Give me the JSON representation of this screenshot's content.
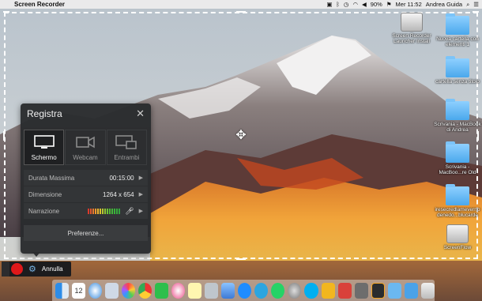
{
  "menubar": {
    "app_name": "Screen Recorder",
    "battery": "90%",
    "clock": "Mer 11:52",
    "user": "Andrea Guida"
  },
  "desktop_icons": [
    {
      "label": "Screen Recorder Launcher Install",
      "kind": "drive"
    },
    {
      "label": "Nuova cartella con elementi 1",
      "kind": "folder"
    },
    {
      "label": "cartella senza titolo",
      "kind": "folder"
    },
    {
      "label": "Scrivania - MacBook di Andrea",
      "kind": "folder"
    },
    {
      "label": "Scrivania - MacBoo...re Old",
      "kind": "folder"
    },
    {
      "label": "iresecredlameverno denedo...blucarde",
      "kind": "folder"
    },
    {
      "label": "ScreenFlow",
      "kind": "drive"
    }
  ],
  "panel": {
    "title": "Registra",
    "sources": [
      {
        "label": "Schermo",
        "icon": "monitor-icon",
        "active": true
      },
      {
        "label": "Webcam",
        "icon": "camera-icon",
        "active": false
      },
      {
        "label": "Entrambi",
        "icon": "screen-and-camera-icon",
        "active": false
      }
    ],
    "rows": {
      "duration_label": "Durata Massima",
      "duration_value": "00:15:00",
      "size_label": "Dimensione",
      "size_value": "1264 x 654",
      "narration_label": "Narrazione"
    },
    "preferences_label": "Preferenze..."
  },
  "toolbar": {
    "cancel_label": "Annulla"
  },
  "colors": {
    "panel_bg": "#2a2c2e",
    "record_red": "#e0191a",
    "gear_blue": "#7ab7e8"
  }
}
